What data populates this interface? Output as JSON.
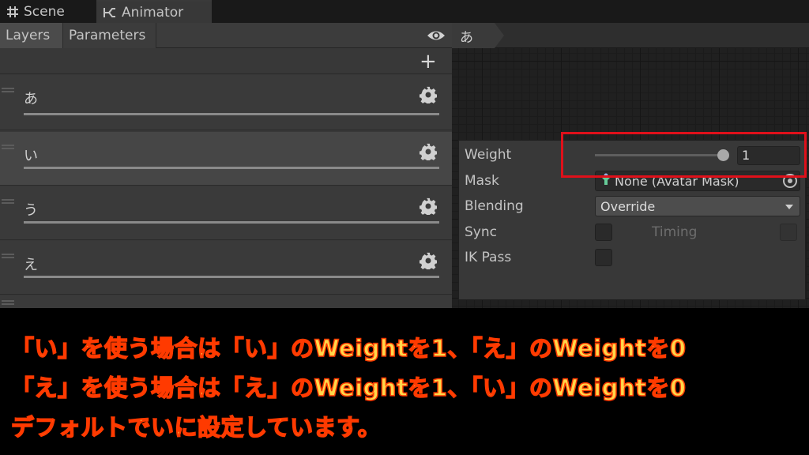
{
  "tabs": [
    {
      "label": "Scene",
      "icon": "grid-icon"
    },
    {
      "label": "Animator",
      "icon": "animator-icon"
    }
  ],
  "left_panel": {
    "subtabs": [
      "Layers",
      "Parameters"
    ],
    "layers": [
      {
        "name": "あ"
      },
      {
        "name": "い"
      },
      {
        "name": "う"
      },
      {
        "name": "え"
      }
    ]
  },
  "graph": {
    "breadcrumb": "あ"
  },
  "layer_settings": {
    "weight_label": "Weight",
    "weight_value": "1",
    "weight_fraction": 1.0,
    "mask_label": "Mask",
    "mask_value": "None (Avatar Mask)",
    "blending_label": "Blending",
    "blending_value": "Override",
    "sync_label": "Sync",
    "timing_label": "Timing",
    "ikpass_label": "IK Pass"
  },
  "caption": {
    "line1": "「い」を使う場合は「い」のWeightを1、「え」のWeightを0",
    "line2": "「え」を使う場合は「え」のWeightを1、「い」のWeightを0",
    "line3": "デフォルトでいに設定しています。",
    "fill_color": "#ffd84a",
    "outline_color": "#ff3a00"
  },
  "colors": {
    "highlight": "#e0101a",
    "panel": "#383838",
    "graph_bg": "#202020"
  }
}
